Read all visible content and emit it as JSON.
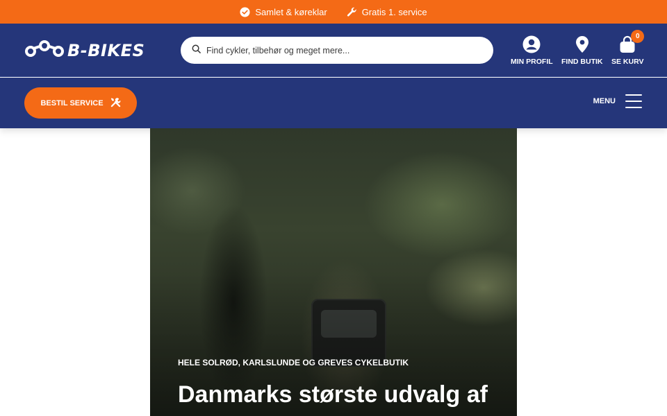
{
  "topbar": {
    "usps": [
      {
        "icon": "check-circle-icon",
        "label": "Samlet & køreklar"
      },
      {
        "icon": "wrench-icon",
        "label": "Gratis 1. service"
      }
    ]
  },
  "header": {
    "logo_text": "B-BIKES",
    "search_placeholder": "Find cykler, tilbehør og meget mere...",
    "links": {
      "profile": "MIN PROFIL",
      "store": "FIND BUTIK",
      "cart": "SE KURV"
    },
    "cart_count": "0"
  },
  "subbar": {
    "service_button": "BESTIL SERVICE",
    "menu_label": "MENU"
  },
  "hero": {
    "eyebrow": "HELE SOLRØD, KARLSLUNDE OG GREVES CYKELBUTIK",
    "title": "Danmarks største udvalg af"
  },
  "colors": {
    "accent": "#f46a16",
    "brand": "#25367a"
  }
}
